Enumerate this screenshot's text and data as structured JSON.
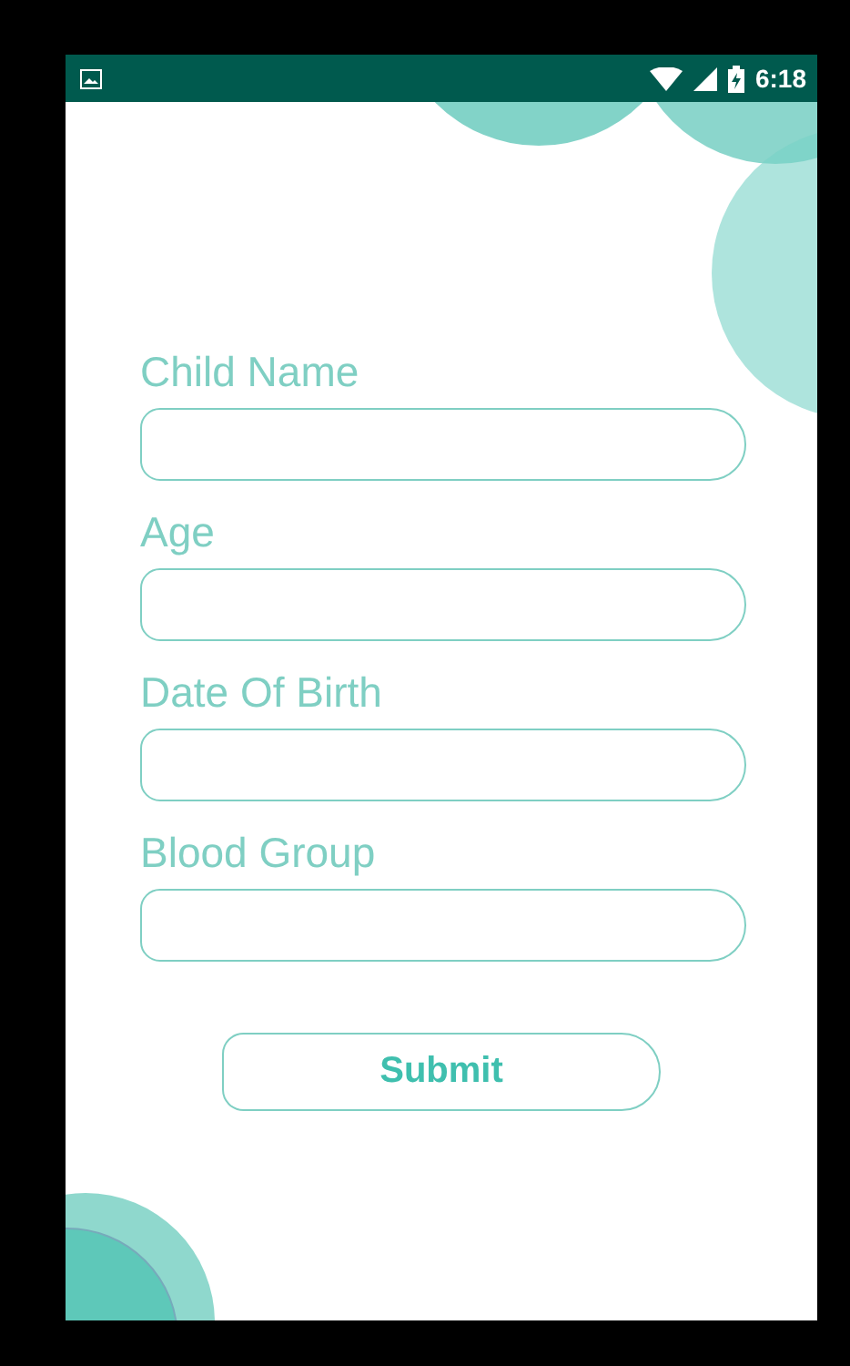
{
  "status_bar": {
    "time": "6:18"
  },
  "form": {
    "fields": [
      {
        "label": "Child Name"
      },
      {
        "label": "Age"
      },
      {
        "label": "Date Of Birth"
      },
      {
        "label": "Blood Group"
      }
    ],
    "submit_button": "Submit"
  }
}
